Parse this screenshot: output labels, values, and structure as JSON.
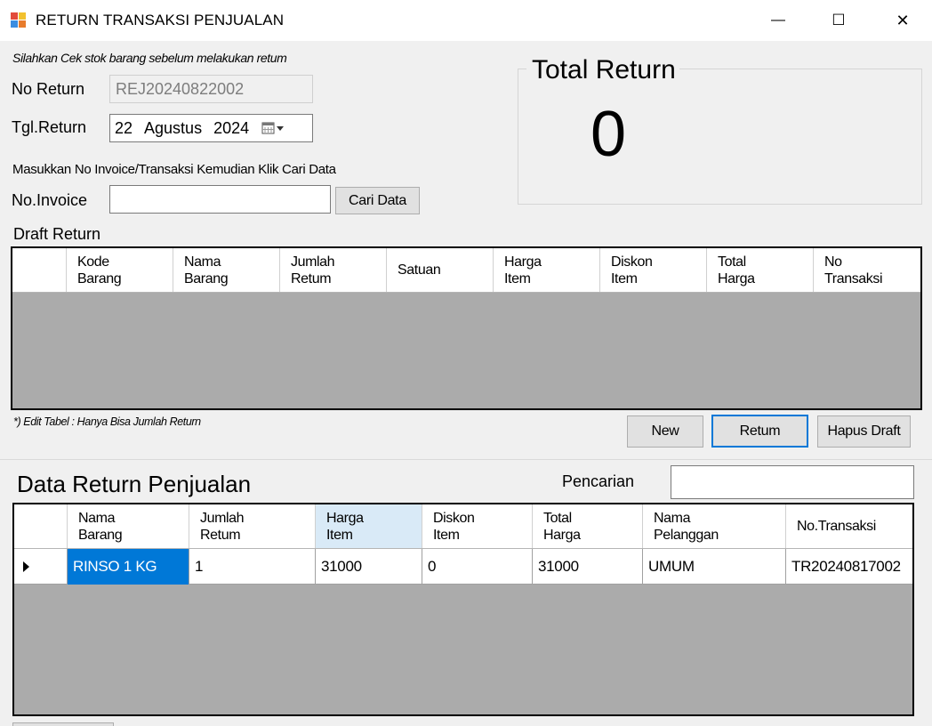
{
  "window": {
    "title": "RETURN TRANSAKSI PENJUALAN",
    "minimize_glyph": "—",
    "maximize_glyph": "☐",
    "close_glyph": "✕"
  },
  "form": {
    "note": "Silahkan Cek stok barang sebelum melakukan retum",
    "no_return_label": "No Return",
    "no_return_value": "REJ20240822002",
    "tgl_return_label": "Tgl.Return",
    "date_day": "22",
    "date_month": "Agustus",
    "date_year": "2024",
    "invoice_instruction": "Masukkan No Invoice/Transaksi Kemudian Klik Cari Data",
    "invoice_label": "No.Invoice",
    "invoice_value": "",
    "search_button": "Cari Data"
  },
  "total_return": {
    "title": "Total Return",
    "value": "0"
  },
  "draft": {
    "title": "Draft Return",
    "columns": [
      {
        "line1": "Kode",
        "line2": "Barang"
      },
      {
        "line1": "Nama",
        "line2": "Barang"
      },
      {
        "line1": "Jumlah",
        "line2": "Retum"
      },
      {
        "line1": "Satuan",
        "line2": ""
      },
      {
        "line1": "Harga",
        "line2": "Item"
      },
      {
        "line1": "Diskon",
        "line2": "Item"
      },
      {
        "line1": "Total",
        "line2": "Harga"
      },
      {
        "line1": "No",
        "line2": "Transaksi"
      }
    ],
    "edit_note": "*) Edit Tabel : Hanya Bisa Jumlah Return",
    "buttons": {
      "new": "New",
      "return": "Retum",
      "delete": "Hapus Draft"
    }
  },
  "data_return": {
    "title": "Data Return Penjualan",
    "search_label": "Pencarian",
    "search_value": "",
    "columns": [
      {
        "line1": "Nama",
        "line2": "Barang"
      },
      {
        "line1": "Jumlah",
        "line2": "Retum"
      },
      {
        "line1": "Harga",
        "line2": "Item"
      },
      {
        "line1": "Diskon",
        "line2": "Item"
      },
      {
        "line1": "Total",
        "line2": "Harga"
      },
      {
        "line1": "Nama",
        "line2": "Pelanggan"
      },
      {
        "line1": "No.Transaksi",
        "line2": ""
      }
    ],
    "rows": [
      [
        "RINSO 1 KG",
        "1",
        "31000",
        "0",
        "31000",
        "UMUM",
        "TR20240817002"
      ]
    ]
  },
  "colors": {
    "selection": "#0078d7",
    "highlight_header": "#d9eaf7",
    "grid_background": "#ababab"
  }
}
